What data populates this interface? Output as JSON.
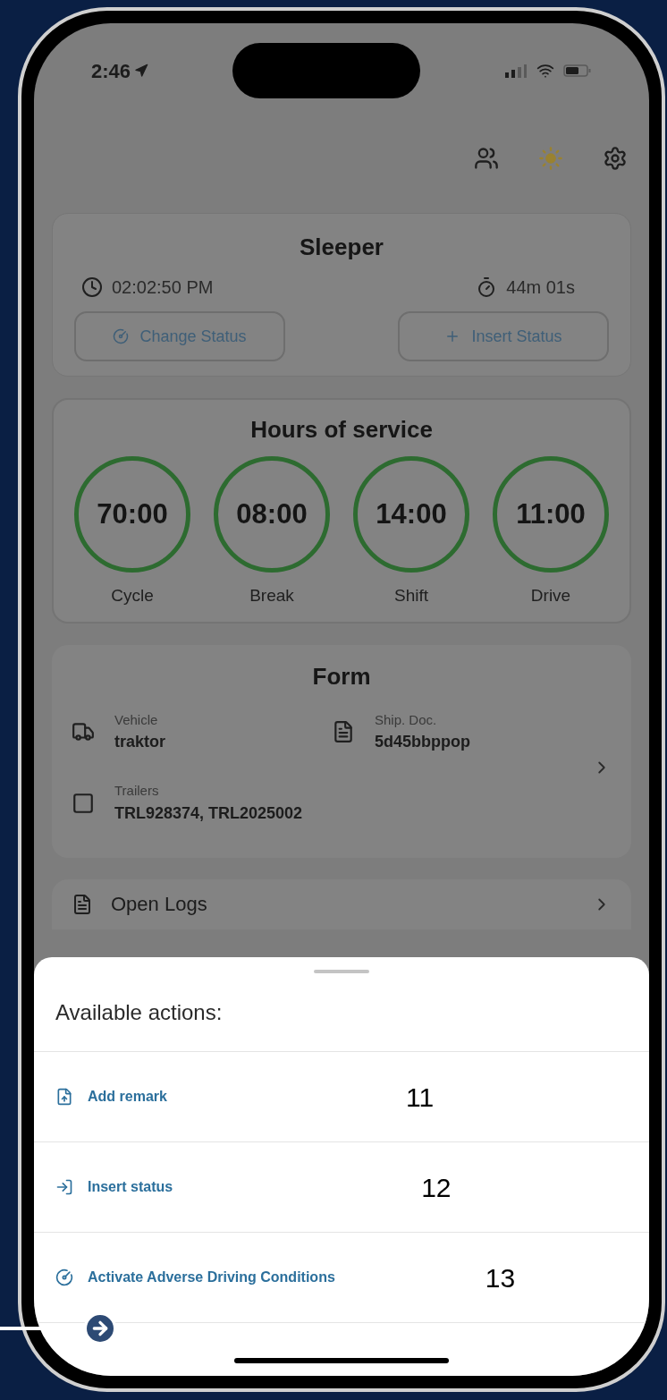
{
  "status_bar": {
    "time": "2:46"
  },
  "status_card": {
    "title": "Sleeper",
    "start_time": "02:02:50 PM",
    "duration": "44m 01s",
    "buttons": [
      {
        "kind": "change",
        "label": "Change Status"
      },
      {
        "kind": "insert",
        "label": "Insert Status"
      }
    ]
  },
  "hours_of_service": {
    "title": "Hours of service",
    "timers": [
      {
        "value": "70:00",
        "label": "Cycle"
      },
      {
        "value": "08:00",
        "label": "Break"
      },
      {
        "value": "14:00",
        "label": "Shift"
      },
      {
        "value": "11:00",
        "label": "Drive"
      }
    ]
  },
  "form": {
    "title": "Form",
    "fields": [
      {
        "kind": "vehicle",
        "label": "Vehicle",
        "value": "traktor"
      },
      {
        "kind": "document",
        "label": "Ship. Doc.",
        "value": "5d45bbppop"
      },
      {
        "kind": "trailer",
        "label": "Trailers",
        "value": "TRL928374, TRL2025002"
      }
    ]
  },
  "open_logs": {
    "label": "Open Logs"
  },
  "action_sheet": {
    "title": "Available actions:",
    "actions": [
      {
        "kind": "remark",
        "label": "Add remark",
        "annotation": "11"
      },
      {
        "kind": "insert",
        "label": "Insert status",
        "annotation": "12"
      },
      {
        "kind": "adverse",
        "label": "Activate Adverse Driving Conditions",
        "annotation": "13"
      }
    ]
  }
}
